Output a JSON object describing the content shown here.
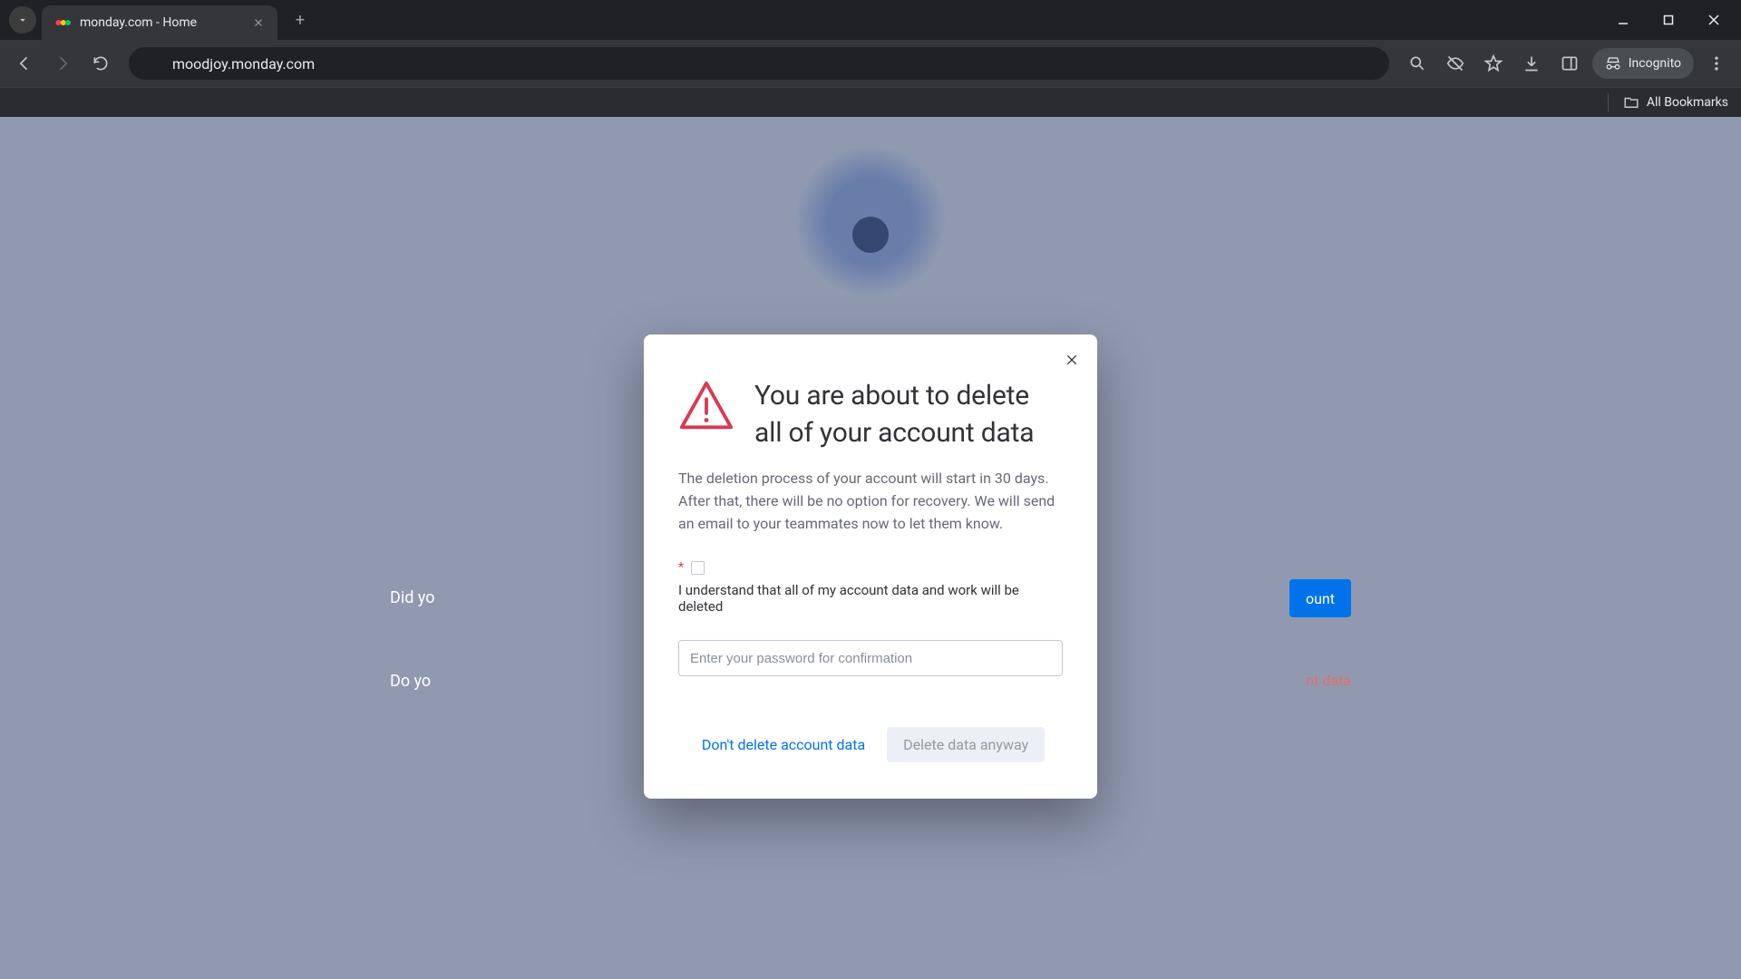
{
  "browser": {
    "tab_title": "monday.com - Home",
    "url": "moodjoy.monday.com",
    "incognito_label": "Incognito",
    "all_bookmarks_label": "All Bookmarks"
  },
  "background": {
    "question1_prefix": "Did yo",
    "primary_button_suffix": "ount",
    "question2_prefix": "Do yo",
    "danger_link_suffix": "nt data"
  },
  "modal": {
    "title": "You are about to delete all of your account data",
    "body": "The deletion process of your account will start in 30 days. After that, there will be no option for recovery. We will send an email to your teammates now to let them know.",
    "required_mark": "*",
    "consent_label": "I understand that all of my account data and work will be deleted",
    "password_placeholder": "Enter your password for confirmation",
    "cancel_label": "Don't delete account data",
    "confirm_label": "Delete data anyway"
  }
}
